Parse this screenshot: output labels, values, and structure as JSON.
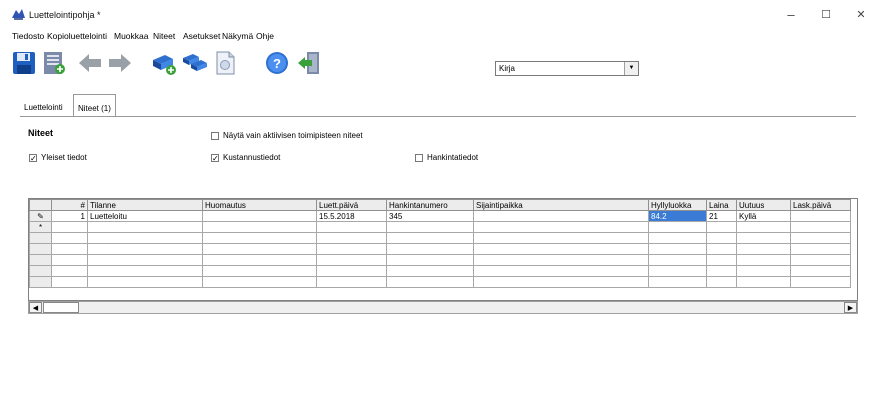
{
  "window": {
    "title": "Luettelointipohja *",
    "minimize": "–",
    "maximize": "☐",
    "close": "✕"
  },
  "menu": [
    "Tiedosto",
    "Kopioluettelointi",
    "Muokkaa",
    "Niteet",
    "Asetukset",
    "Näkymä",
    "Ohje"
  ],
  "toolbar": {
    "icons": [
      "save-icon",
      "save-new-icon",
      "back-arrow-icon",
      "forward-arrow-icon",
      "books-add-icon",
      "books-copy-icon",
      "document-icon",
      "help-icon",
      "exit-icon"
    ]
  },
  "material_type": {
    "selected": "Kirja"
  },
  "tabs": [
    {
      "label": "Luettelointi",
      "active": false
    },
    {
      "label": "Niteet (1)",
      "active": true
    }
  ],
  "section": {
    "title": "Niteet",
    "checkboxes": {
      "only_active": {
        "label": "Näytä vain aktiivisen toimipisteen niteet",
        "checked": false
      },
      "general": {
        "label": "Yleiset tiedot",
        "checked": true
      },
      "publisher": {
        "label": "Kustannustiedot",
        "checked": true
      },
      "acquisition": {
        "label": "Hankintatiedot",
        "checked": false
      }
    }
  },
  "grid": {
    "columns": [
      "#",
      "Tilanne",
      "Huomautus",
      "Luett.päivä",
      "Hankintanumero",
      "Sijaintipaikka",
      "Hyllyluokka",
      "Laina",
      "Uutuus",
      "Lask.päivä"
    ],
    "rows": [
      [
        "1",
        "Luetteloitu",
        "",
        "15.5.2018",
        "345",
        "",
        "84.2",
        "21",
        "Kyllä",
        ""
      ]
    ],
    "new_row_marker": "*",
    "edit_marker": "✎"
  },
  "scrollbar": {
    "left": "◀",
    "right": "▶"
  }
}
